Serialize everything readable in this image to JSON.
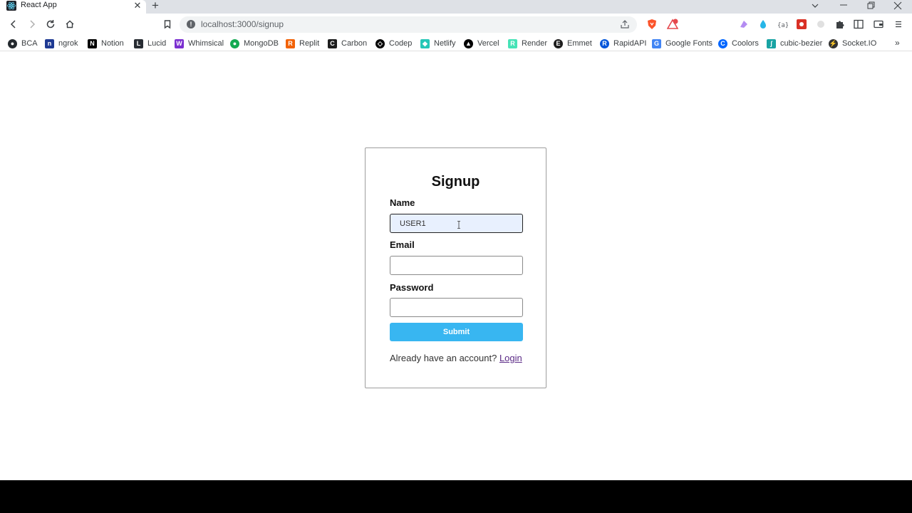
{
  "browser": {
    "tab_title": "React App",
    "tab_close": "✕",
    "new_tab": "+",
    "url": "localhost:3000/signup",
    "bookmarks": [
      {
        "label": "BCA",
        "color": "#24292e",
        "glyph": "●"
      },
      {
        "label": "ngrok",
        "color": "#1f1e37",
        "glyph": "n"
      },
      {
        "label": "Notion",
        "color": "#000000",
        "glyph": "N"
      },
      {
        "label": "Lucid",
        "color": "#282c33",
        "glyph": "L"
      },
      {
        "label": "Whimsical",
        "color": "#7b2fd0",
        "glyph": "W"
      },
      {
        "label": "MongoDB",
        "color": "#13aa52",
        "glyph": "●"
      },
      {
        "label": "Replit",
        "color": "#f26207",
        "glyph": "R"
      },
      {
        "label": "Carbon",
        "color": "#1e1e1e",
        "glyph": "C"
      },
      {
        "label": "Codep",
        "color": "#000000",
        "glyph": "◇"
      },
      {
        "label": "Netlify",
        "color": "#25c7b7",
        "glyph": "◆"
      },
      {
        "label": "Vercel",
        "color": "#000000",
        "glyph": "▲"
      },
      {
        "label": "Render",
        "color": "#46e3b7",
        "glyph": "R"
      },
      {
        "label": "Emmet",
        "color": "#1e1e1e",
        "glyph": "E"
      },
      {
        "label": "RapidAPI",
        "color": "#0055da",
        "glyph": "R"
      },
      {
        "label": "Google Fonts",
        "color": "#4285f4",
        "glyph": "G"
      },
      {
        "label": "Coolors",
        "color": "#0066ff",
        "glyph": "C"
      },
      {
        "label": "cubic-bezier",
        "color": "#19a3a3",
        "glyph": "∫"
      },
      {
        "label": "Socket.IO",
        "color": "#333333",
        "glyph": "⚡"
      }
    ],
    "bookmarks_more": "»"
  },
  "signup": {
    "title": "Signup",
    "name_label": "Name",
    "name_value": "USER1",
    "email_label": "Email",
    "email_value": "",
    "password_label": "Password",
    "password_value": "",
    "submit_label": "Submit",
    "footer_text": "Already have an account?",
    "login_link": "Login"
  },
  "colors": {
    "accent": "#38b6f1",
    "link": "#5b2a86"
  }
}
